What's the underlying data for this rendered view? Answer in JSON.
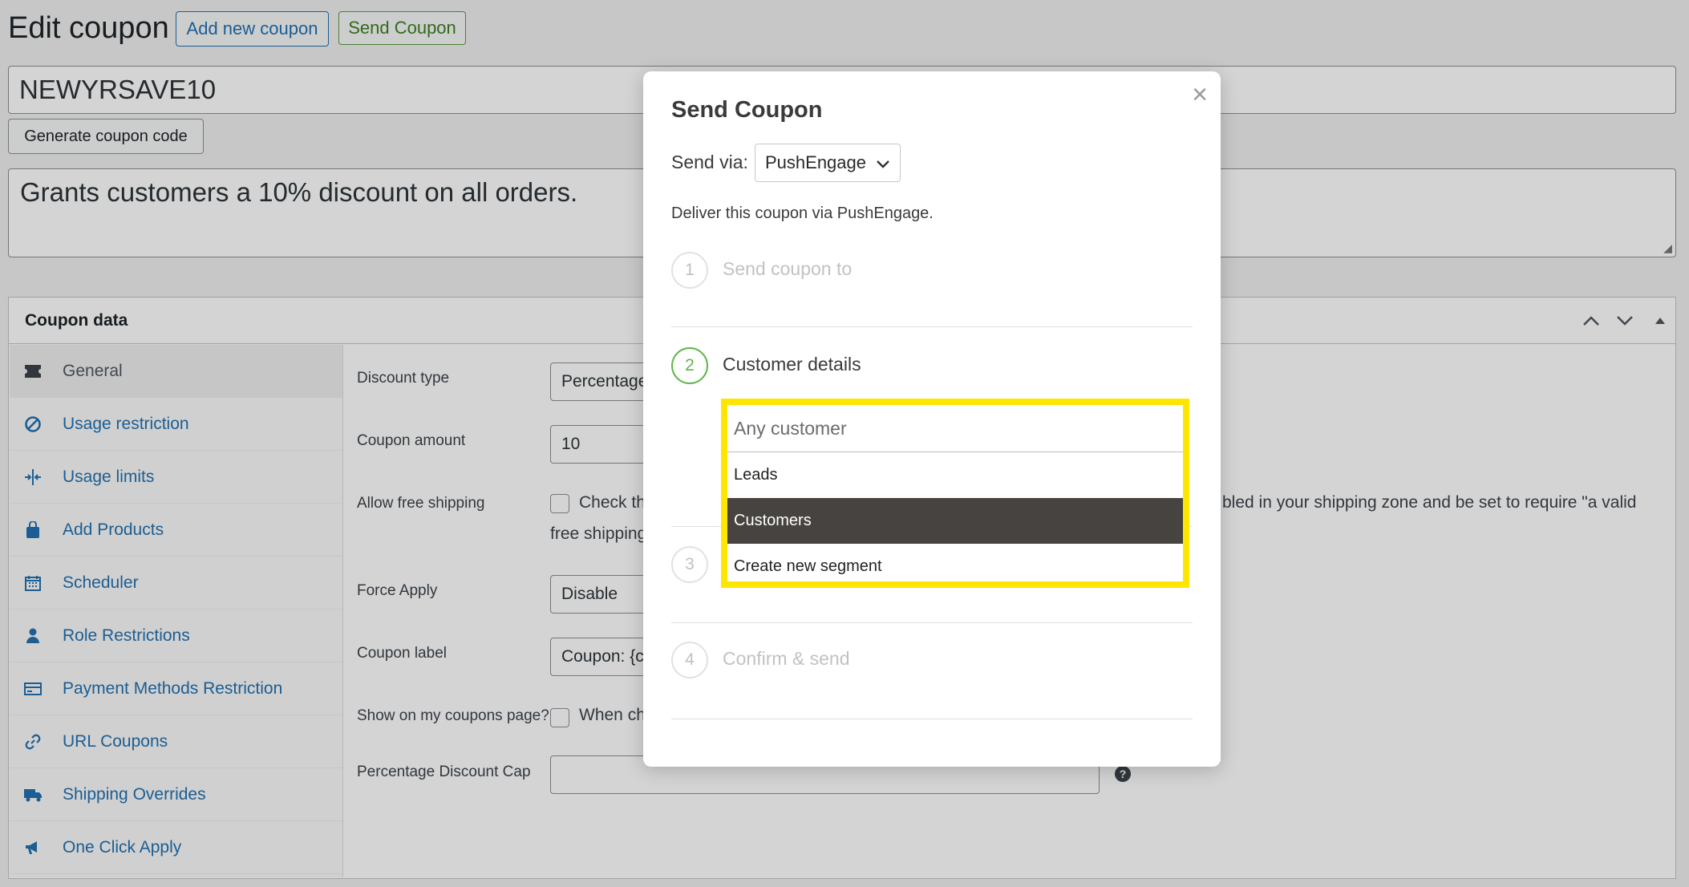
{
  "header": {
    "title": "Edit coupon",
    "add_new": "Add new coupon",
    "send": "Send Coupon"
  },
  "coupon": {
    "code": "NEWYRSAVE10",
    "generate_label": "Generate coupon code",
    "description": "Grants customers a 10% discount on all orders."
  },
  "coupon_data": {
    "title": "Coupon data",
    "tabs": [
      {
        "label": "General",
        "icon": "ticket-icon"
      },
      {
        "label": "Usage restriction",
        "icon": "ban-icon"
      },
      {
        "label": "Usage limits",
        "icon": "limits-icon"
      },
      {
        "label": "Add Products",
        "icon": "bag-icon"
      },
      {
        "label": "Scheduler",
        "icon": "calendar-icon"
      },
      {
        "label": "Role Restrictions",
        "icon": "user-icon"
      },
      {
        "label": "Payment Methods Restriction",
        "icon": "card-icon"
      },
      {
        "label": "URL Coupons",
        "icon": "link-icon"
      },
      {
        "label": "Shipping Overrides",
        "icon": "truck-icon"
      },
      {
        "label": "One Click Apply",
        "icon": "megaphone-icon"
      }
    ],
    "fields": {
      "discount_type_label": "Discount type",
      "discount_type_value": "Percentage",
      "amount_label": "Coupon amount",
      "amount_value": "10",
      "free_shipping_label": "Allow free shipping",
      "free_shipping_text_start": "Check th",
      "free_shipping_text_end": "bled in your shipping zone and be set to require \"a valid",
      "free_shipping_text_line2": "free shipping",
      "force_apply_label": "Force Apply",
      "force_apply_value": "Disable",
      "coupon_label_label": "Coupon label",
      "coupon_label_value": "Coupon: {c",
      "show_on_page_label": "Show on my coupons page?",
      "show_on_page_text": "When ch",
      "cap_label": "Percentage Discount Cap"
    }
  },
  "modal": {
    "title": "Send Coupon",
    "close": "×",
    "send_via_label": "Send via:",
    "send_via_value": "PushEngage",
    "description": "Deliver this coupon via PushEngage.",
    "steps": [
      {
        "num": "1",
        "label": "Send coupon to"
      },
      {
        "num": "2",
        "label": "Customer details"
      },
      {
        "num": "3",
        "label": ""
      },
      {
        "num": "4",
        "label": "Confirm & send"
      }
    ],
    "dropdown": {
      "placeholder": "Any customer",
      "options": [
        "Leads",
        "Customers",
        "Create new segment"
      ],
      "selected": "Customers"
    }
  },
  "colors": {
    "highlight": "#ffe600",
    "selected_bg": "#464340",
    "step_active": "#5fb649",
    "link": "#2271b1"
  }
}
